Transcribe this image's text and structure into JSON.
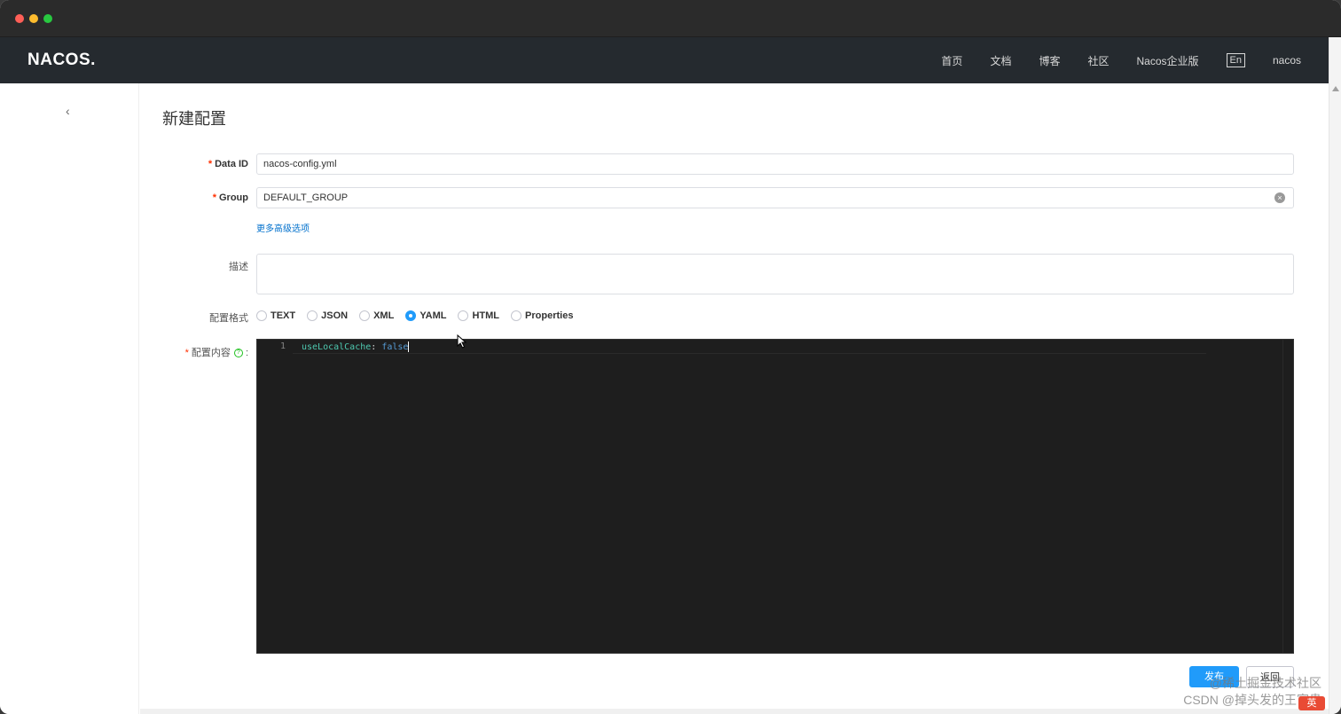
{
  "app": {
    "logo": "NACOS."
  },
  "nav": {
    "items": [
      "首页",
      "文档",
      "博客",
      "社区",
      "Nacos企业版"
    ],
    "lang": "En",
    "user": "nacos"
  },
  "page": {
    "title": "新建配置"
  },
  "form": {
    "data_id": {
      "label": "Data ID",
      "required_mark": "*",
      "value": "nacos-config.yml"
    },
    "group": {
      "label": "Group",
      "required_mark": "*",
      "value": "DEFAULT_GROUP"
    },
    "advanced_link": "更多高级选项",
    "description": {
      "label": "描述",
      "value": ""
    },
    "format": {
      "label": "配置格式",
      "options": [
        "TEXT",
        "JSON",
        "XML",
        "YAML",
        "HTML",
        "Properties"
      ],
      "selected": "YAML"
    },
    "content": {
      "label": "配置内容",
      "required_mark": "*",
      "colon": ":",
      "lines": [
        {
          "number": "1",
          "key": "useLocalCache",
          "sep": ": ",
          "value": "false"
        }
      ]
    }
  },
  "buttons": {
    "publish": "发布",
    "back": "返回"
  },
  "watermark": {
    "line1": "@稀土掘金技术社区",
    "line2": "CSDN @掉头发的王富贵"
  },
  "ime": {
    "label": "英"
  },
  "colors": {
    "navbar": "#252a2f",
    "primary": "#209bfa",
    "editor_bg": "#1e1e1e",
    "required": "#ff3000",
    "link": "#0070cc"
  }
}
